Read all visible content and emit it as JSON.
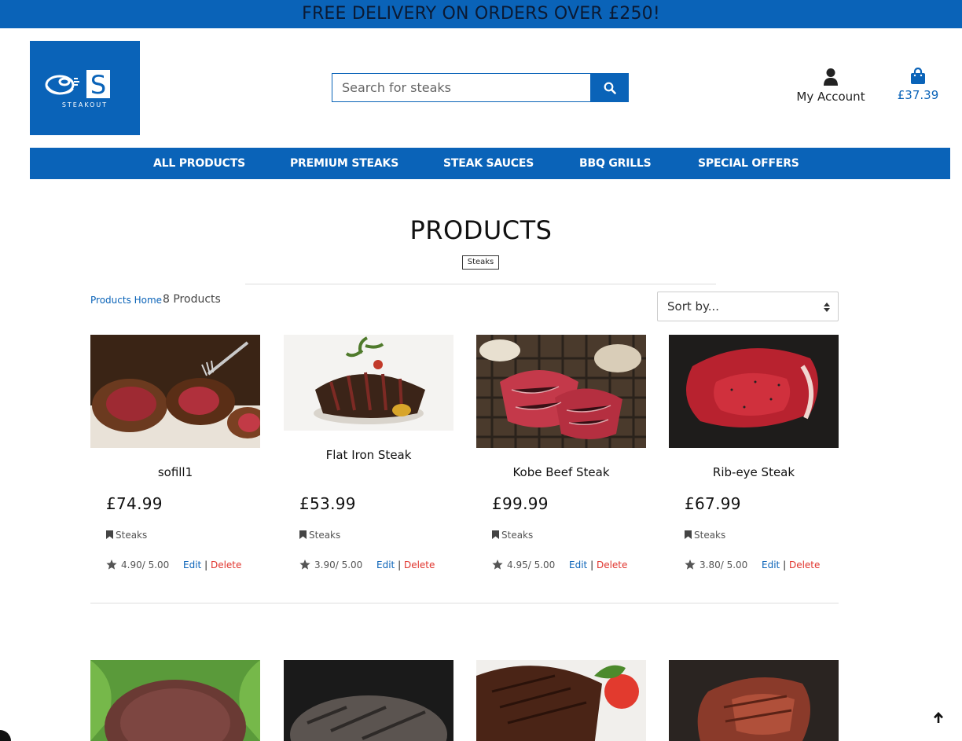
{
  "promo": {
    "text": "FREE DELIVERY ON ORDERS OVER £250!"
  },
  "logo": {
    "letter": "S",
    "brand_text": "STEAKOUT"
  },
  "search": {
    "placeholder": "Search for steaks",
    "icon": "search-icon"
  },
  "account": {
    "label": "My Account",
    "icon": "user-icon"
  },
  "cart": {
    "total": "£37.39",
    "icon": "shopping-bag-icon"
  },
  "nav": {
    "items": [
      {
        "label": "ALL PRODUCTS"
      },
      {
        "label": "PREMIUM STEAKS"
      },
      {
        "label": "STEAK SAUCES"
      },
      {
        "label": "BBQ GRILLS"
      },
      {
        "label": "SPECIAL OFFERS"
      }
    ]
  },
  "main": {
    "title": "PRODUCTS",
    "category_tag": "Steaks",
    "breadcrumb": "Products Home",
    "count": "8 Products",
    "sort_label": "Sort by..."
  },
  "products": [
    {
      "name": "sofill1",
      "price": "£74.99",
      "category": "Steaks",
      "rating": "4.90/ 5.00",
      "edit": "Edit",
      "sep": "|",
      "delete": "Delete"
    },
    {
      "name": "Flat Iron Steak",
      "price": "£53.99",
      "category": "Steaks",
      "rating": "3.90/ 5.00",
      "edit": "Edit",
      "sep": "|",
      "delete": "Delete"
    },
    {
      "name": "Kobe Beef Steak",
      "price": "£99.99",
      "category": "Steaks",
      "rating": "4.95/ 5.00",
      "edit": "Edit",
      "sep": "|",
      "delete": "Delete"
    },
    {
      "name": "Rib-eye Steak",
      "price": "£67.99",
      "category": "Steaks",
      "rating": "3.80/ 5.00",
      "edit": "Edit",
      "sep": "|",
      "delete": "Delete"
    }
  ],
  "colors": {
    "brand": "#0a63b8",
    "delete": "#e0342d"
  }
}
